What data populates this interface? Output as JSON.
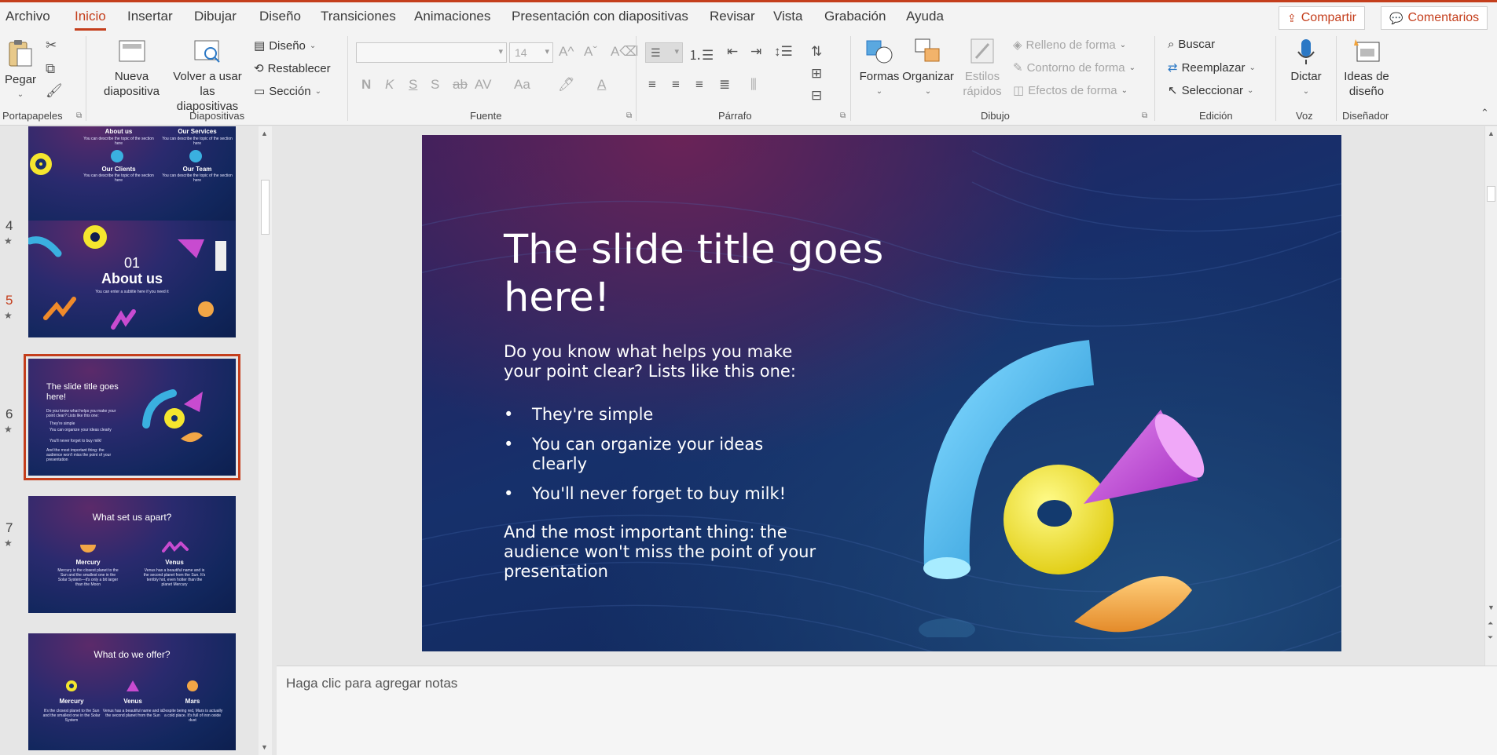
{
  "menu": {
    "tabs": [
      "Archivo",
      "Inicio",
      "Insertar",
      "Dibujar",
      "Diseño",
      "Transiciones",
      "Animaciones",
      "Presentación con diapositivas",
      "Revisar",
      "Vista",
      "Grabación",
      "Ayuda"
    ],
    "active_tab": "Inicio",
    "share_label": "Compartir",
    "comments_label": "Comentarios"
  },
  "ribbon": {
    "portapapeles": {
      "paste": "Pegar",
      "label": "Portapapeles"
    },
    "diapositivas": {
      "new_slide_1": "Nueva",
      "new_slide_2": "diapositiva",
      "reuse_1": "Volver a usar",
      "reuse_2": "las diapositivas",
      "layout": "Diseño",
      "reset": "Restablecer",
      "section": "Sección",
      "label": "Diapositivas"
    },
    "fuente": {
      "size": "14",
      "label": "Fuente"
    },
    "parrafo": {
      "label": "Párrafo"
    },
    "dibujo": {
      "shapes": "Formas",
      "arrange": "Organizar",
      "quick_styles_1": "Estilos",
      "quick_styles_2": "rápidos",
      "fill": "Relleno de forma",
      "outline": "Contorno de forma",
      "effects": "Efectos de forma",
      "label": "Dibujo"
    },
    "edicion": {
      "find": "Buscar",
      "replace": "Reemplazar",
      "select": "Seleccionar",
      "label": "Edición"
    },
    "voz": {
      "dictate": "Dictar",
      "label": "Voz"
    },
    "disenador": {
      "ideas_1": "Ideas de",
      "ideas_2": "diseño",
      "label": "Diseñador"
    }
  },
  "thumbnails": [
    {
      "num": "",
      "items": [
        "About us",
        "Our Services",
        "Our Clients",
        "Our Team"
      ],
      "sub": "You can describe the topic of the section here"
    },
    {
      "num": "4",
      "big": "01",
      "title": "About us",
      "sub": "You can enter a subtitle here if you need it"
    },
    {
      "num": "5",
      "title": "The slide title goes here!",
      "selected": true
    },
    {
      "num": "6",
      "title": "What set us apart?",
      "cols": [
        "Mercury",
        "Venus"
      ],
      "texts": [
        "Mercury is the closest planet to the Sun and the smallest one in the Solar System—it's only a bit larger than the Moon",
        "Venus has a beautiful name and is the second planet from the Sun. It's terribly hot, even hotter than the planet Mercury"
      ]
    },
    {
      "num": "7",
      "title": "What do we offer?",
      "cols": [
        "Mercury",
        "Venus",
        "Mars"
      ],
      "texts": [
        "It's the closest planet to the Sun and the smallest one in the Solar System",
        "Venus has a beautiful name and is the second planet from the Sun",
        "Despite being red, Mars is actually a cold place. It's full of iron oxide dust"
      ]
    }
  ],
  "slide": {
    "title": "The slide title goes here!",
    "intro": "Do you know what helps you make your point clear? Lists like this one:",
    "bullets": [
      "They're simple",
      "You can organize your ideas clearly",
      "You'll never forget to buy milk!"
    ],
    "outro": "And the most important thing: the audience won't miss the point of your presentation"
  },
  "notes": {
    "placeholder": "Haga clic para agregar notas"
  },
  "colors": {
    "accent": "#c43e1c",
    "ribbon_bg": "#f3f3f3",
    "pane_bg": "#e6e6e6"
  }
}
